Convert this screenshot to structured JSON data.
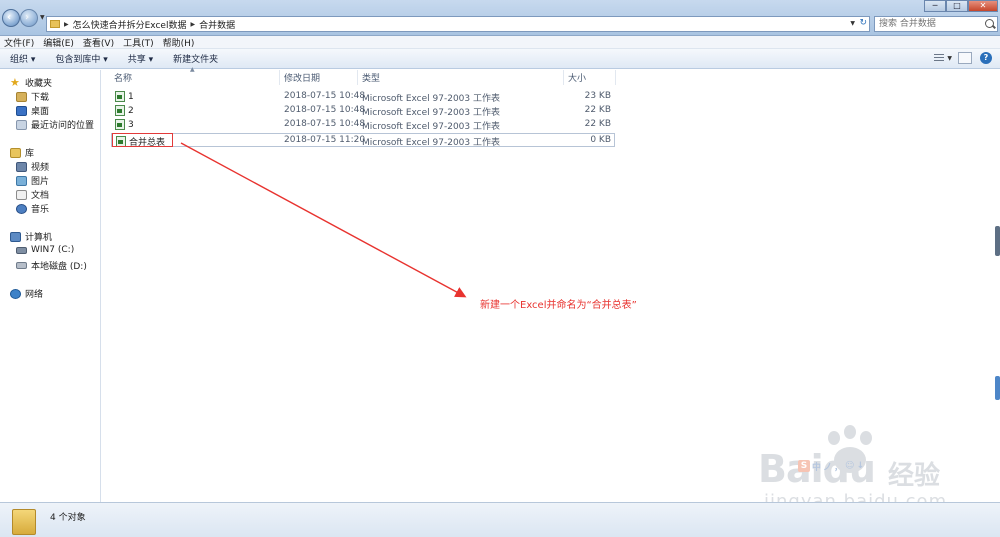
{
  "address": {
    "crumbs": [
      "怎么快速合并拆分Excel数据",
      "合并数据"
    ],
    "search_placeholder": "搜索 合并数据"
  },
  "window_controls": [
    "─",
    "□",
    "✕"
  ],
  "menu": [
    "文件(F)",
    "编辑(E)",
    "查看(V)",
    "工具(T)",
    "帮助(H)"
  ],
  "toolbar": {
    "organize": "组织 ▾",
    "include_library": "包含到库中 ▾",
    "share": "共享 ▾",
    "new_folder": "新建文件夹"
  },
  "sidebar": {
    "favorites": {
      "label": "收藏夹",
      "items": [
        "下载",
        "桌面",
        "最近访问的位置"
      ]
    },
    "libraries": {
      "label": "库",
      "items": [
        "视频",
        "图片",
        "文档",
        "音乐"
      ]
    },
    "computer": {
      "label": "计算机",
      "items": [
        "WIN7 (C:)",
        "本地磁盘 (D:)"
      ]
    },
    "network": {
      "label": "网络"
    }
  },
  "columns": {
    "name": "名称",
    "modified": "修改日期",
    "type": "类型",
    "size": "大小"
  },
  "files": [
    {
      "name": "1",
      "modified": "2018-07-15 10:48",
      "type": "Microsoft Excel 97-2003 工作表",
      "size": "23 KB"
    },
    {
      "name": "2",
      "modified": "2018-07-15 10:48",
      "type": "Microsoft Excel 97-2003 工作表",
      "size": "22 KB"
    },
    {
      "name": "3",
      "modified": "2018-07-15 10:48",
      "type": "Microsoft Excel 97-2003 工作表",
      "size": "22 KB"
    },
    {
      "name": "合并总表",
      "modified": "2018-07-15 11:20",
      "type": "Microsoft Excel 97-2003 工作表",
      "size": "0 KB"
    }
  ],
  "annotation": "新建一个Excel并命名为“合并总表”",
  "status": "4 个对象",
  "watermark": {
    "brand": "Baidu",
    "jingyan": "经验",
    "url": "jingyan.baidu.com",
    "ime": [
      "中",
      "ノ",
      "，",
      "☺",
      "↓"
    ]
  },
  "colors": {
    "annotation": "#e8332f",
    "selection_border": "#e23a3a",
    "excel_green": "#2d7a2d"
  }
}
